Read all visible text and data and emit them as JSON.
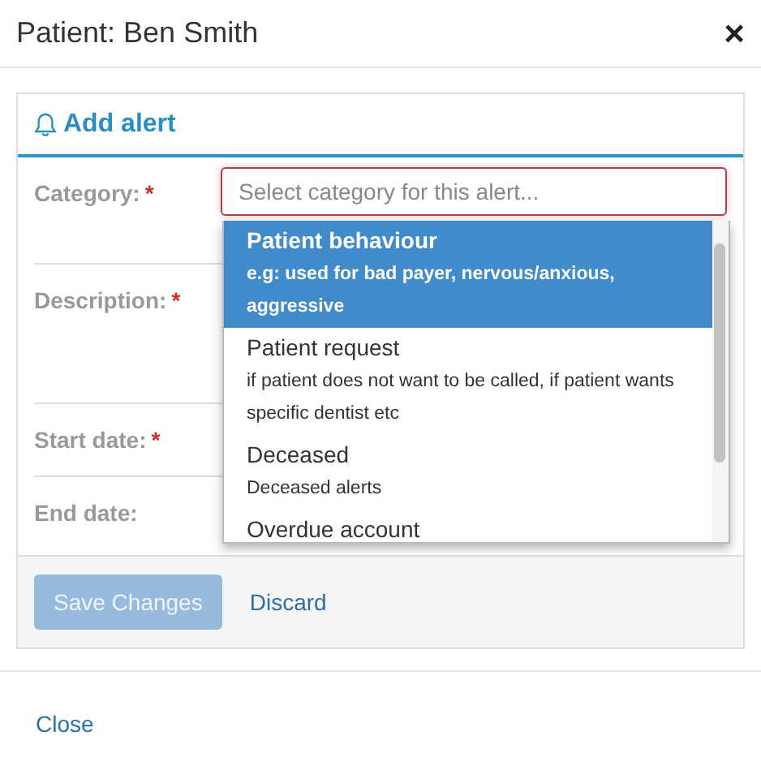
{
  "modal": {
    "title": "Patient: Ben Smith",
    "close_icon": "×"
  },
  "panel": {
    "heading": "Add alert"
  },
  "form": {
    "fields": [
      {
        "label": "Category:",
        "required_mark": "*",
        "kind": "select",
        "placeholder": "Select category for this alert..."
      },
      {
        "label": "Description:",
        "required_mark": "*",
        "kind": "textarea"
      },
      {
        "label": "Start date:",
        "required_mark": "*",
        "kind": "date"
      },
      {
        "label": "End date:",
        "kind": "date"
      }
    ]
  },
  "dropdown": {
    "options": [
      {
        "title": "Patient behaviour",
        "description": "e.g: used for bad payer, nervous/anxious, aggressive",
        "selected": true
      },
      {
        "title": "Patient request",
        "description": "if patient does not want to be called, if patient wants specific dentist etc",
        "selected": false
      },
      {
        "title": "Deceased",
        "description": "Deceased alerts",
        "selected": false
      },
      {
        "title": "Overdue account",
        "selected": false
      }
    ]
  },
  "panel_footer": {
    "save_button": {
      "label": "Save Changes",
      "disabled": true
    },
    "discard_link": "Discard"
  },
  "modal_footer": {
    "close_link": "Close"
  }
}
